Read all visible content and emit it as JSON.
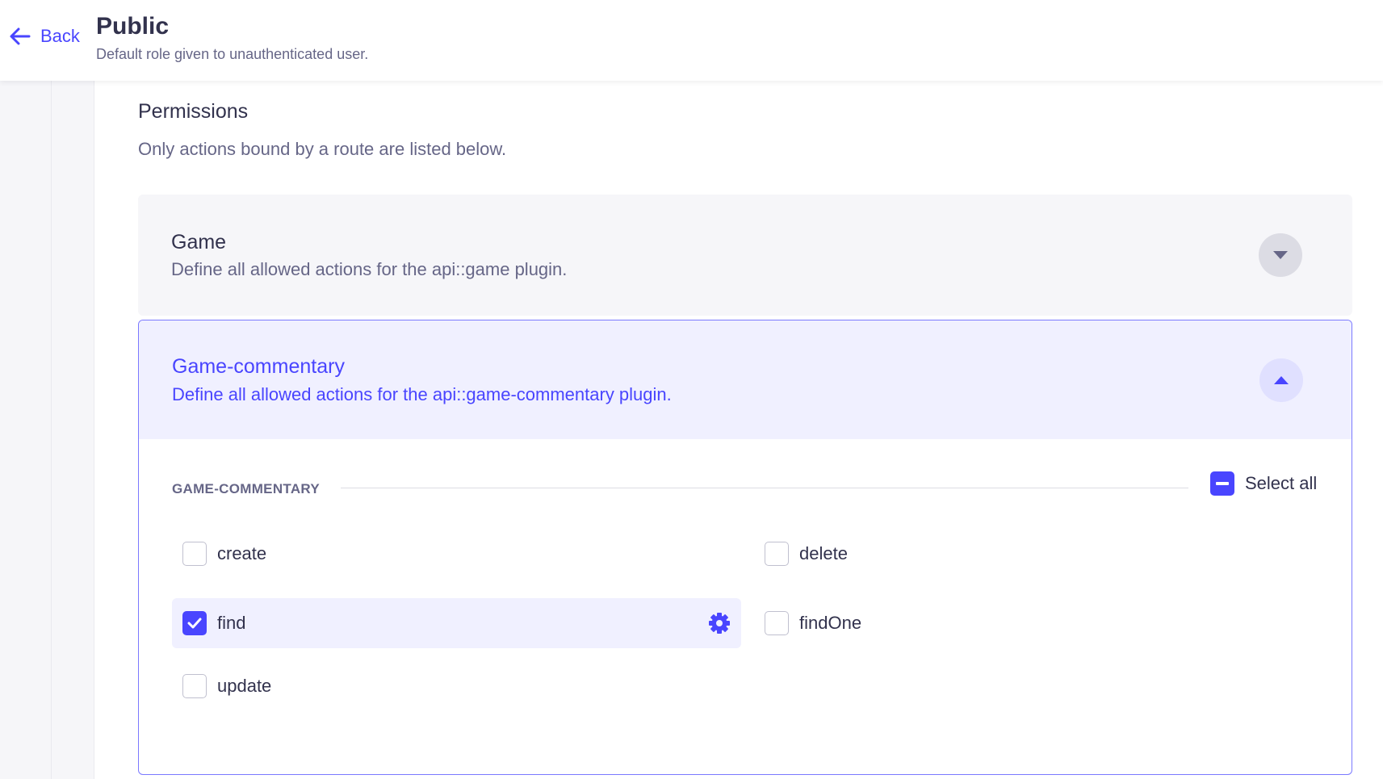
{
  "header": {
    "back_label": "Back",
    "title": "Public",
    "subtitle": "Default role given to unauthenticated user."
  },
  "permissions": {
    "title": "Permissions",
    "description": "Only actions bound by a route are listed below."
  },
  "accordions": [
    {
      "title": "Game",
      "description": "Define all allowed actions for the api::game plugin.",
      "expanded": false
    },
    {
      "title": "Game-commentary",
      "description": "Define all allowed actions for the api::game-commentary plugin.",
      "expanded": true,
      "section_label": "GAME-COMMENTARY",
      "select_all_label": "Select all",
      "select_all_state": "indeterminate",
      "actions": [
        {
          "label": "create",
          "checked": false
        },
        {
          "label": "delete",
          "checked": false
        },
        {
          "label": "find",
          "checked": true
        },
        {
          "label": "findOne",
          "checked": false
        },
        {
          "label": "update",
          "checked": false
        }
      ]
    }
  ],
  "colors": {
    "accent": "#4945ff",
    "accent_light": "#f0f0ff",
    "text": "#32324d",
    "muted": "#666687"
  }
}
